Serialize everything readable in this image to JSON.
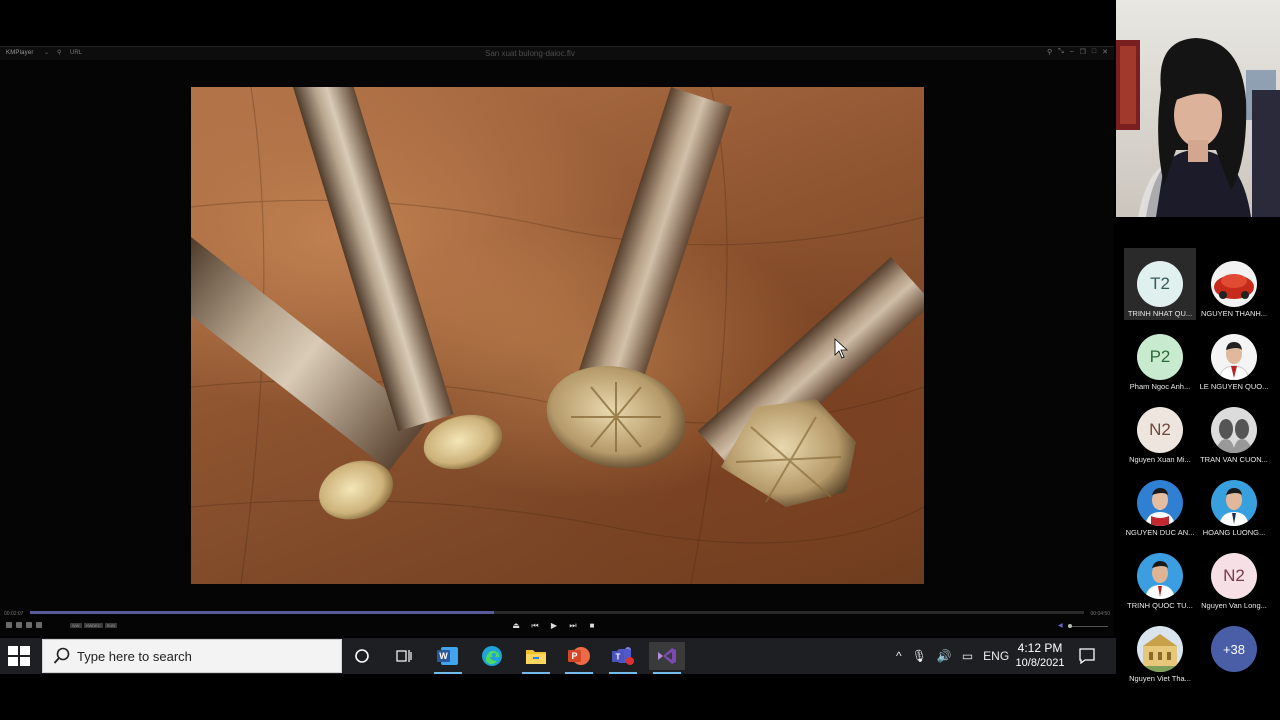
{
  "player": {
    "brand": "KMPlayer",
    "arrow": "⌄",
    "url_label": "URL",
    "file_title": "San xuat bulong-daioc.flv",
    "time_elapsed": "00:02:07",
    "time_total": "00:04:50",
    "progress": 0.44,
    "tags": [
      "S/W",
      "HWDEC",
      "SUB"
    ],
    "controls": {
      "eject": "⏏",
      "prev": "⏮",
      "play": "▶",
      "next": "⏭",
      "stop": "■"
    }
  },
  "taskbar": {
    "search_placeholder": "Type here to search",
    "tray_lang": "ENG",
    "tray_caret": "^",
    "clock_time": "4:12 PM",
    "clock_date": "10/8/2021",
    "colors": {
      "word": "#2b579a",
      "edge": "#1fa3d8",
      "explorer": "#f2c232",
      "powerpoint": "#d24726",
      "teams": "#5059c9",
      "vs": "#7b4ab0"
    }
  },
  "participants": [
    {
      "initials": "T2",
      "name": "TRINH NHAT QU...",
      "style": "txt-t2"
    },
    {
      "initials": "",
      "name": "NGUYEN THANH...",
      "style": "photo-car"
    },
    {
      "initials": "P2",
      "name": "Pham Ngoc Anh...",
      "style": "txt-p2"
    },
    {
      "initials": "",
      "name": "LE NGUYEN QUO...",
      "style": "photo-man"
    },
    {
      "initials": "N2",
      "name": "Nguyen Xuan Mi...",
      "style": "txt-n2"
    },
    {
      "initials": "",
      "name": "TRAN VAN CUON...",
      "style": "photo-gray"
    },
    {
      "initials": "",
      "name": "NGUYEN DUC AN...",
      "style": "photo-man2"
    },
    {
      "initials": "",
      "name": "HOANG LUONG...",
      "style": "photo-man3"
    },
    {
      "initials": "",
      "name": "TRINH QUOC TU...",
      "style": "photo-man4"
    },
    {
      "initials": "N2",
      "name": "Nguyen Van Long...",
      "style": "txt-n2b"
    },
    {
      "initials": "",
      "name": "Nguyen Viet Tha...",
      "style": "photo-building"
    },
    {
      "initials": "+38",
      "name": "",
      "style": "more"
    }
  ]
}
